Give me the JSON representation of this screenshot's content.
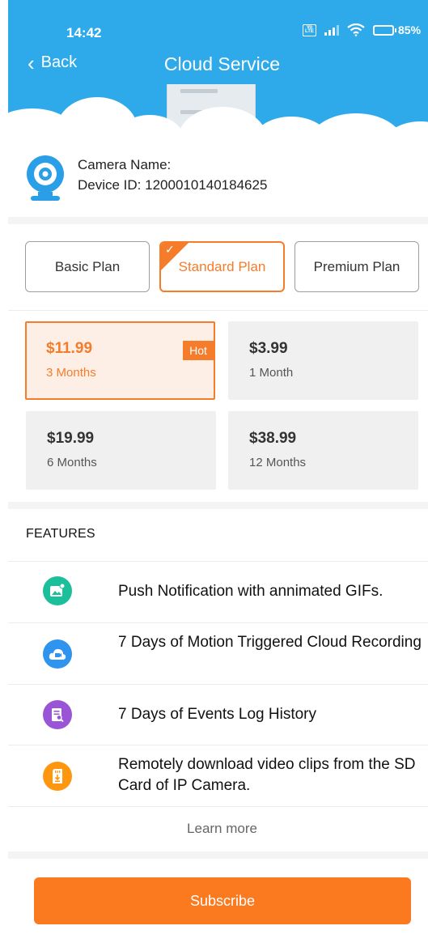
{
  "status_bar": {
    "time": "14:42",
    "network_badge": "Vo LTE",
    "battery_percent": "85%"
  },
  "nav": {
    "back_label": "Back",
    "title": "Cloud Service"
  },
  "camera": {
    "name_label": "Camera Name:",
    "device_id_label": "Device ID: 1200010140184625"
  },
  "plans": [
    {
      "label": "Basic Plan",
      "selected": false
    },
    {
      "label": "Standard Plan",
      "selected": true
    },
    {
      "label": "Premium Plan",
      "selected": false
    }
  ],
  "prices": [
    {
      "amount": "$11.99",
      "duration": "3 Months",
      "badge": "Hot",
      "selected": true
    },
    {
      "amount": "$3.99",
      "duration": "1 Month",
      "selected": false
    },
    {
      "amount": "$19.99",
      "duration": "6 Months",
      "selected": false
    },
    {
      "amount": "$38.99",
      "duration": "12 Months",
      "selected": false
    }
  ],
  "features": {
    "title": "FEATURES",
    "items": [
      {
        "icon": "image-notification-icon",
        "color": "#1bbf9a",
        "text": "Push Notification with annimated GIFs."
      },
      {
        "icon": "cloud-video-icon",
        "color": "#2e94ee",
        "text": "7 Days of Motion Triggered Cloud Recording"
      },
      {
        "icon": "event-log-icon",
        "color": "#9a55d6",
        "text": "7 Days of Events Log History"
      },
      {
        "icon": "sd-card-download-icon",
        "color": "#ff9610",
        "text": "Remotely download video clips from the SD Card of IP Camera."
      }
    ]
  },
  "learn_more": "Learn more",
  "subscribe": "Subscribe",
  "colors": {
    "header": "#2eaaeb",
    "accent": "#f57c2a",
    "subscribe": "#fb7a1f"
  }
}
